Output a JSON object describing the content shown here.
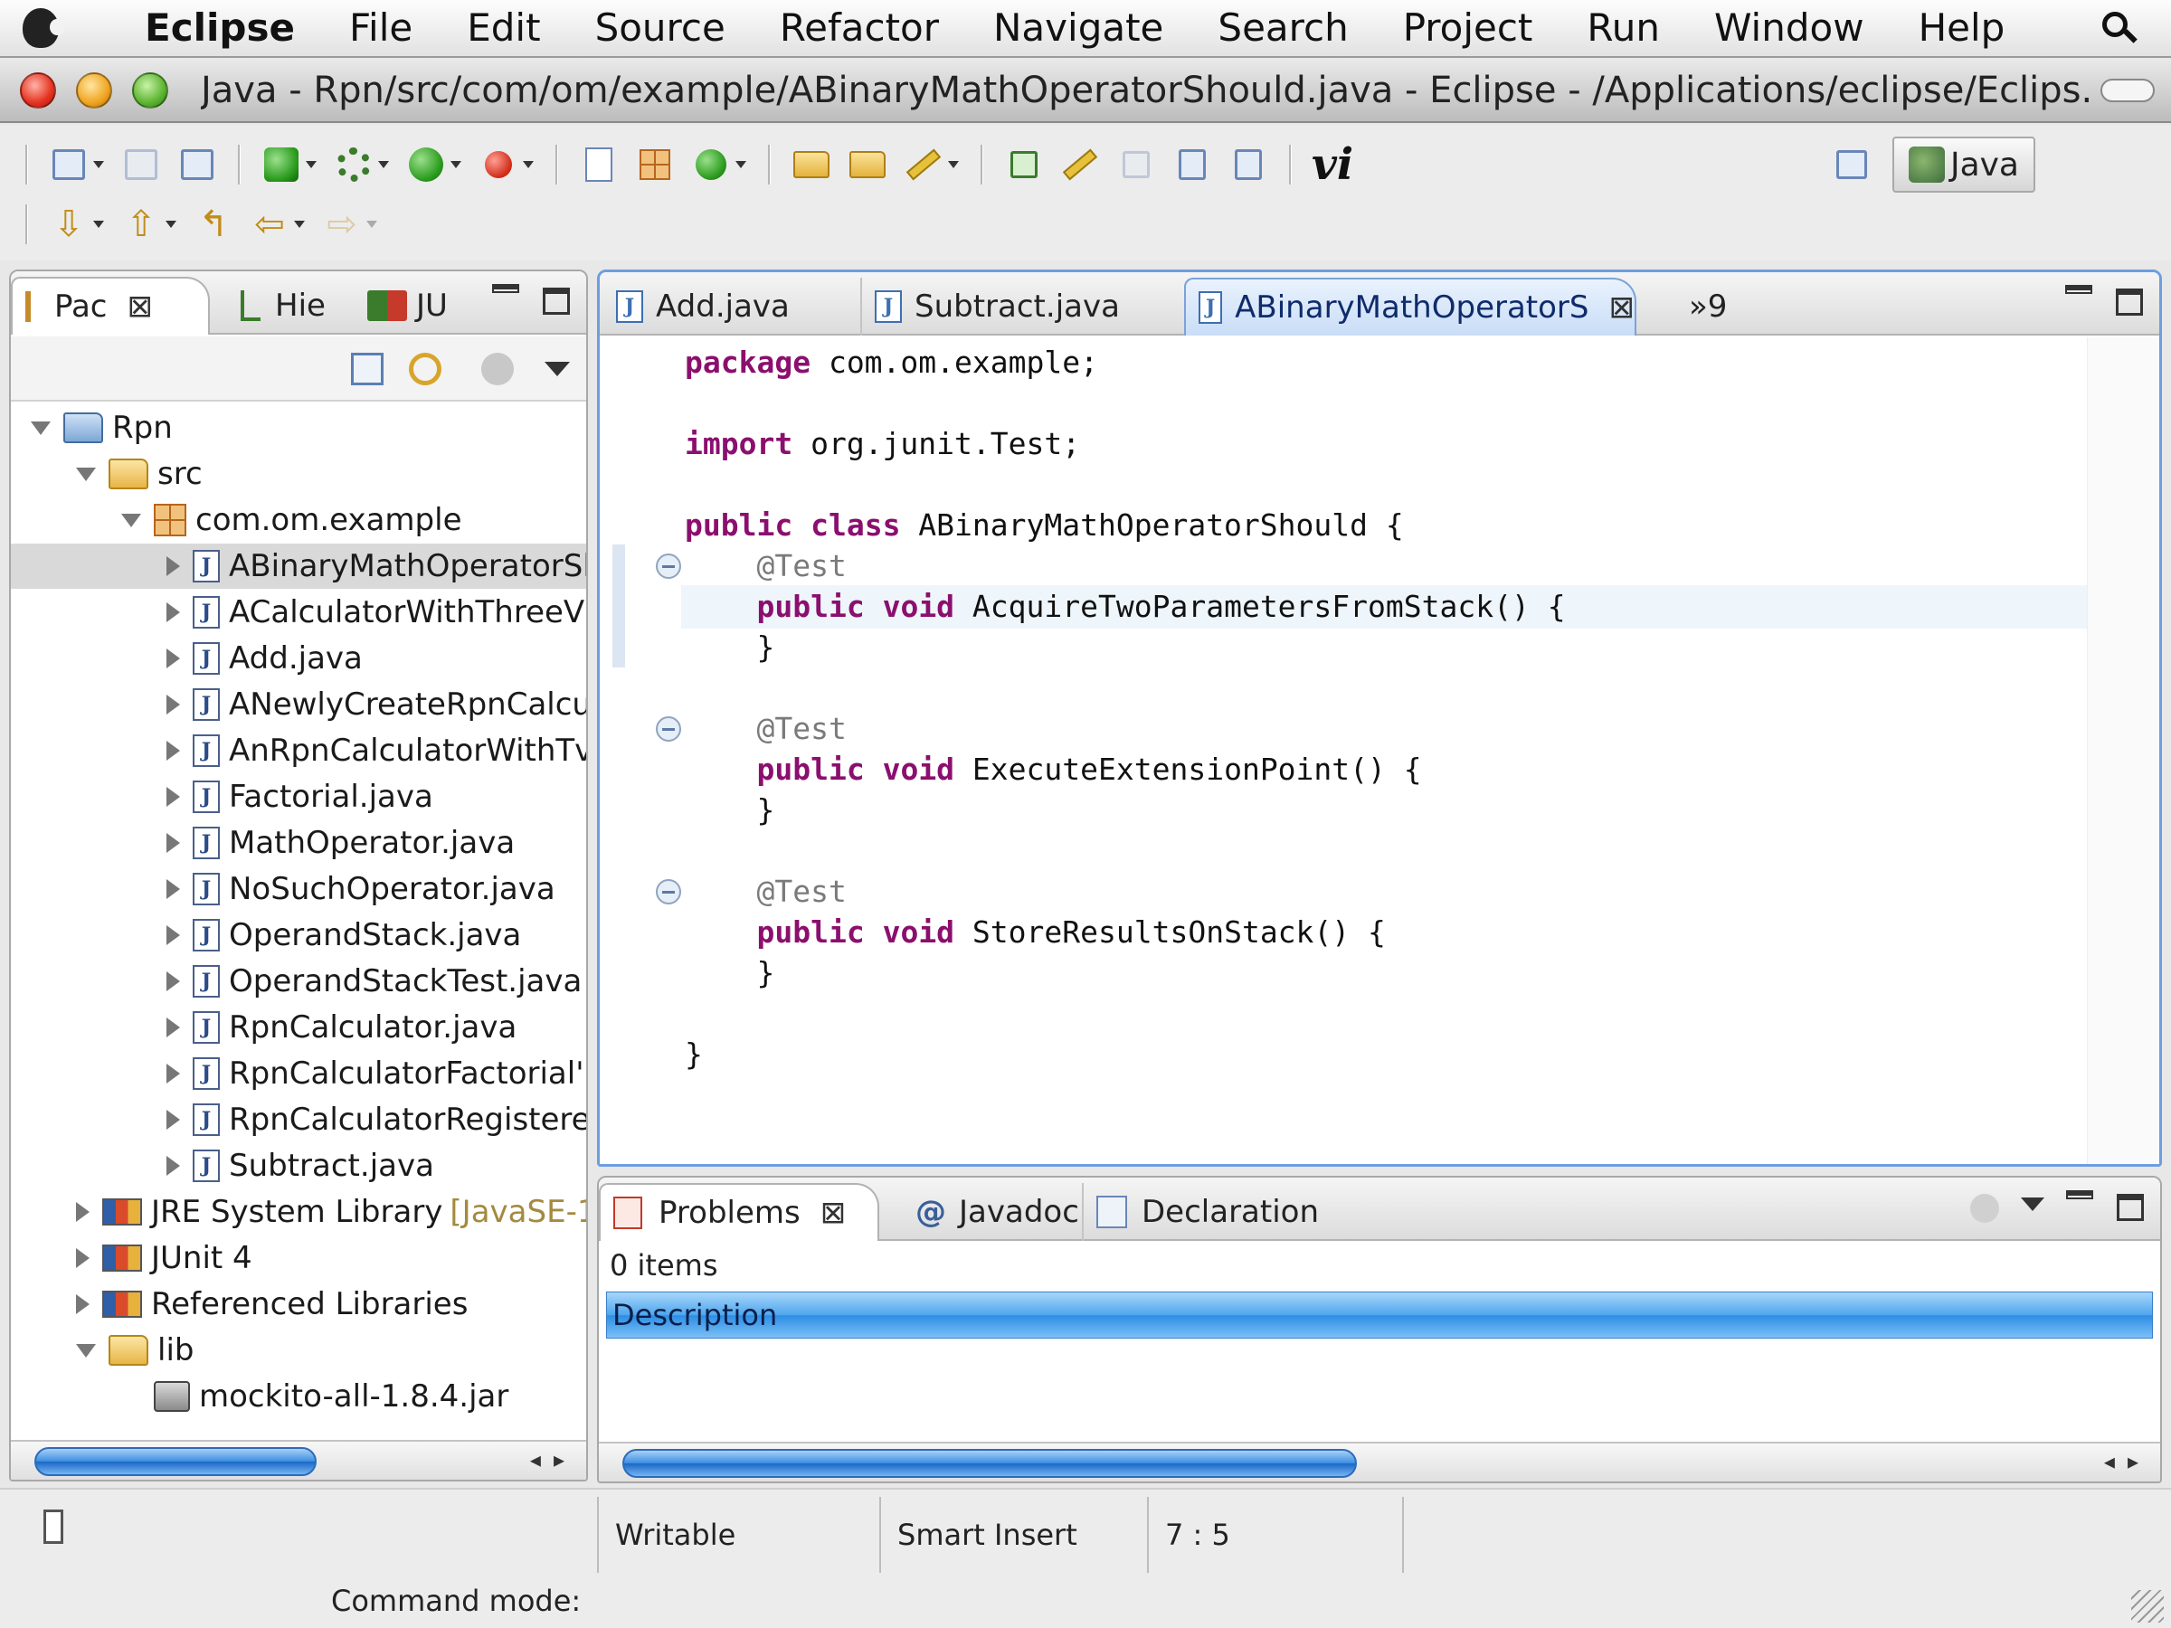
{
  "menubar": {
    "app": "Eclipse",
    "items": [
      "File",
      "Edit",
      "Source",
      "Refactor",
      "Navigate",
      "Search",
      "Project",
      "Run",
      "Window",
      "Help"
    ]
  },
  "window": {
    "title": "Java - Rpn/src/com/om/example/ABinaryMathOperatorShould.java - Eclipse - /Applications/eclipse/Eclips..."
  },
  "toolbar": {
    "vi_label": "vi",
    "perspective": "Java"
  },
  "explorer": {
    "tabs": [
      "Pac",
      "Hie",
      "JU"
    ],
    "tree": [
      {
        "label": "Rpn",
        "depth": 0,
        "state": "open",
        "icon": "project"
      },
      {
        "label": "src",
        "depth": 1,
        "state": "open",
        "icon": "source-folder"
      },
      {
        "label": "com.om.example",
        "depth": 2,
        "state": "open",
        "icon": "package"
      },
      {
        "label": "ABinaryMathOperatorSl",
        "depth": 3,
        "state": "closed",
        "icon": "java-file",
        "selected": true
      },
      {
        "label": "ACalculatorWithThreeV",
        "depth": 3,
        "state": "closed",
        "icon": "java-file"
      },
      {
        "label": "Add.java",
        "depth": 3,
        "state": "closed",
        "icon": "java-file"
      },
      {
        "label": "ANewlyCreateRpnCalcu",
        "depth": 3,
        "state": "closed",
        "icon": "java-file"
      },
      {
        "label": "AnRpnCalculatorWithTv",
        "depth": 3,
        "state": "closed",
        "icon": "java-file"
      },
      {
        "label": "Factorial.java",
        "depth": 3,
        "state": "closed",
        "icon": "java-file"
      },
      {
        "label": "MathOperator.java",
        "depth": 3,
        "state": "closed",
        "icon": "java-file"
      },
      {
        "label": "NoSuchOperator.java",
        "depth": 3,
        "state": "closed",
        "icon": "java-file"
      },
      {
        "label": "OperandStack.java",
        "depth": 3,
        "state": "closed",
        "icon": "java-file"
      },
      {
        "label": "OperandStackTest.java",
        "depth": 3,
        "state": "closed",
        "icon": "java-file"
      },
      {
        "label": "RpnCalculator.java",
        "depth": 3,
        "state": "closed",
        "icon": "java-file"
      },
      {
        "label": "RpnCalculatorFactorial'",
        "depth": 3,
        "state": "closed",
        "icon": "java-file"
      },
      {
        "label": "RpnCalculatorRegistere",
        "depth": 3,
        "state": "closed",
        "icon": "java-file"
      },
      {
        "label": "Subtract.java",
        "depth": 3,
        "state": "closed",
        "icon": "java-file"
      },
      {
        "label": "JRE System Library",
        "suffix": "[JavaSE-1.",
        "depth": 1,
        "state": "closed",
        "icon": "library"
      },
      {
        "label": "JUnit 4",
        "depth": 1,
        "state": "closed",
        "icon": "library"
      },
      {
        "label": "Referenced Libraries",
        "depth": 1,
        "state": "closed",
        "icon": "library"
      },
      {
        "label": "lib",
        "depth": 1,
        "state": "open",
        "icon": "folder"
      },
      {
        "label": "mockito-all-1.8.4.jar",
        "depth": 2,
        "state": "leaf",
        "icon": "jar"
      }
    ]
  },
  "editor": {
    "tabs": [
      "Add.java",
      "Subtract.java",
      "ABinaryMathOperatorS"
    ],
    "overflow": "»9",
    "code": [
      {
        "t": [
          [
            "kw",
            "package"
          ],
          [
            "",
            " com.om.example;"
          ]
        ]
      },
      {
        "t": []
      },
      {
        "t": [
          [
            "kw",
            "import"
          ],
          [
            "",
            " org.junit.Test;"
          ]
        ]
      },
      {
        "t": []
      },
      {
        "t": [
          [
            "kw",
            "public"
          ],
          [
            "",
            " "
          ],
          [
            "kw",
            "class"
          ],
          [
            "",
            " ABinaryMathOperatorShould {"
          ]
        ]
      },
      {
        "t": [
          [
            "",
            "    "
          ],
          [
            "ann",
            "@Test"
          ]
        ],
        "fold": true
      },
      {
        "t": [
          [
            "",
            "    "
          ],
          [
            "kw",
            "public"
          ],
          [
            "",
            " "
          ],
          [
            "kw",
            "void"
          ],
          [
            "",
            " AcquireTwoParametersFromStack() {"
          ]
        ],
        "current": true
      },
      {
        "t": [
          [
            "",
            "    }"
          ]
        ]
      },
      {
        "t": []
      },
      {
        "t": [
          [
            "",
            "    "
          ],
          [
            "ann",
            "@Test"
          ]
        ],
        "fold": true
      },
      {
        "t": [
          [
            "",
            "    "
          ],
          [
            "kw",
            "public"
          ],
          [
            "",
            " "
          ],
          [
            "kw",
            "void"
          ],
          [
            "",
            " ExecuteExtensionPoint() {"
          ]
        ]
      },
      {
        "t": [
          [
            "",
            "    }"
          ]
        ]
      },
      {
        "t": []
      },
      {
        "t": [
          [
            "",
            "    "
          ],
          [
            "ann",
            "@Test"
          ]
        ],
        "fold": true
      },
      {
        "t": [
          [
            "",
            "    "
          ],
          [
            "kw",
            "public"
          ],
          [
            "",
            " "
          ],
          [
            "kw",
            "void"
          ],
          [
            "",
            " StoreResultsOnStack() {"
          ]
        ]
      },
      {
        "t": [
          [
            "",
            "    }"
          ]
        ]
      },
      {
        "t": []
      },
      {
        "t": [
          [
            "",
            "}"
          ]
        ]
      }
    ]
  },
  "problems": {
    "tabs": [
      "Problems",
      "Javadoc",
      "Declaration"
    ],
    "summary": "0 items",
    "column": "Description"
  },
  "status": {
    "writable": "Writable",
    "insert_mode": "Smart Insert",
    "position": "7 : 5",
    "command_mode": "Command mode:"
  },
  "colors": {
    "keyword": "#8b0f6e",
    "annotation": "#7a7a7a",
    "selection_blue": "#2d8de4",
    "editor_border": "#6d9ee0"
  }
}
